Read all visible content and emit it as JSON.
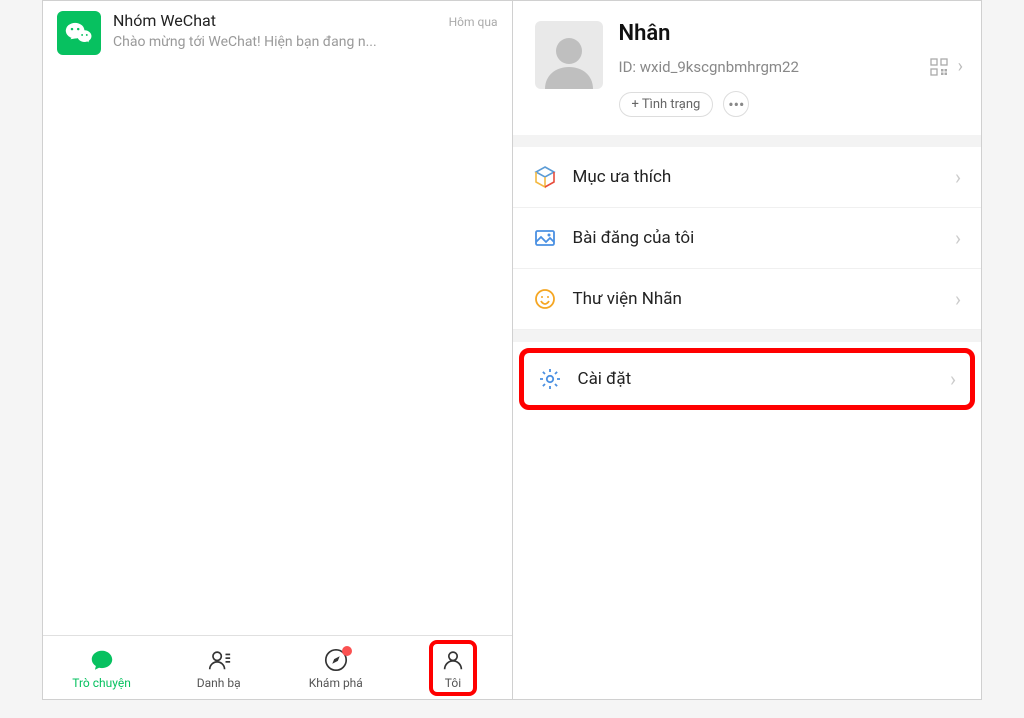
{
  "left": {
    "chat": {
      "title": "Nhóm WeChat",
      "time": "Hôm qua",
      "preview": "Chào mừng tới WeChat! Hiện bạn đang n..."
    },
    "tabs": {
      "chat": "Trò chuyện",
      "contacts": "Danh bạ",
      "discover": "Khám phá",
      "me": "Tôi"
    }
  },
  "right": {
    "profile": {
      "name": "Nhân",
      "id_label": "ID: wxid_9kscgnbmhrgm22",
      "status_button": "+ Tình trạng"
    },
    "menu": {
      "favorites": "Mục ưa thích",
      "posts": "Bài đăng của tôi",
      "stickers": "Thư viện Nhãn",
      "settings": "Cài đặt"
    }
  }
}
